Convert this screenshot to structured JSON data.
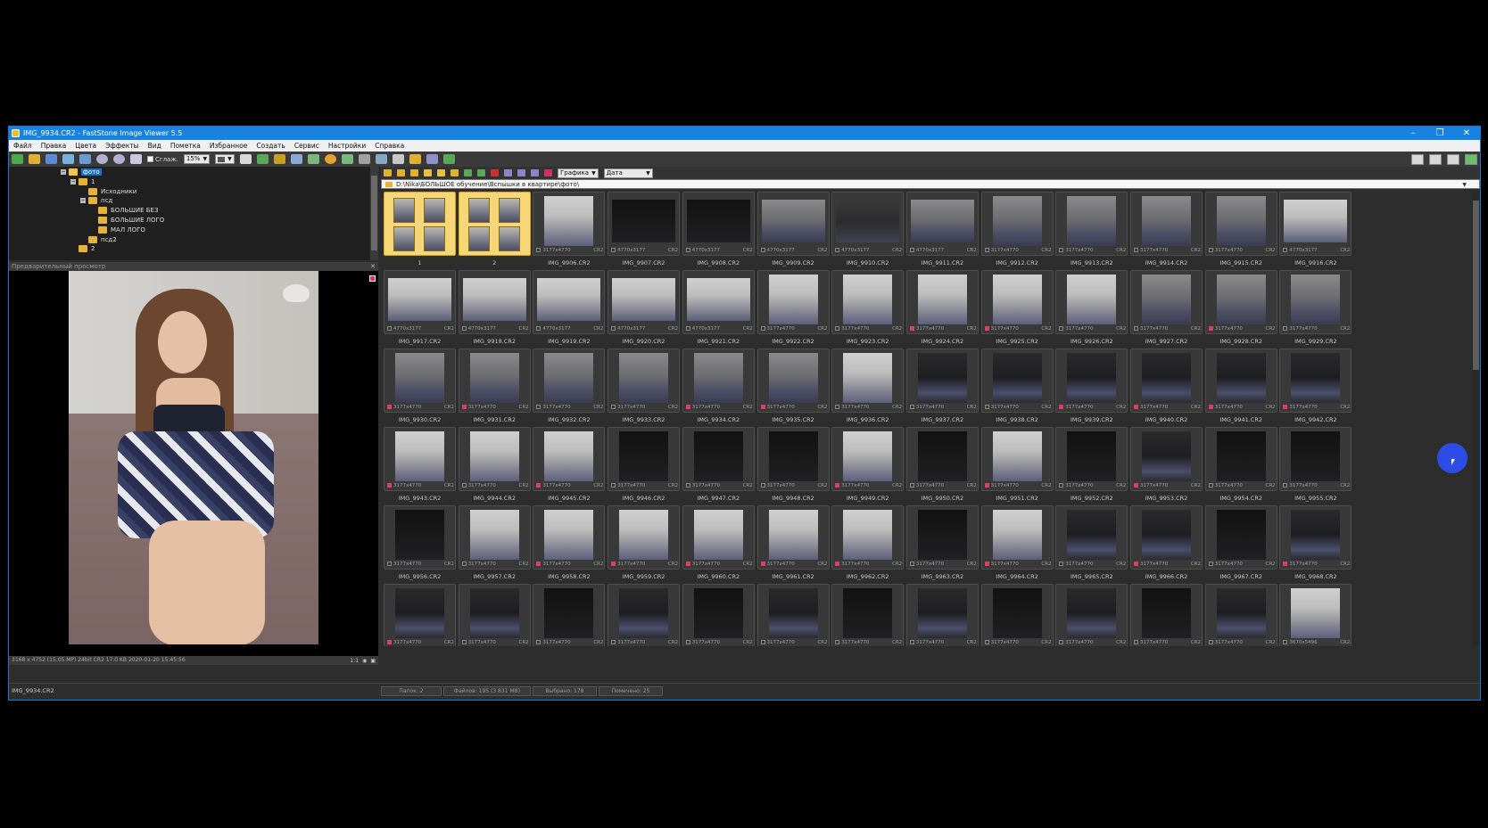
{
  "window": {
    "title": "IMG_9934.CR2 - FastStone Image Viewer 5.5",
    "minimize": "–",
    "maximize": "❐",
    "close": "✕"
  },
  "menu": [
    "Файл",
    "Правка",
    "Цвета",
    "Эффекты",
    "Вид",
    "Пометка",
    "Избранное",
    "Создать",
    "Сервис",
    "Настройки",
    "Справка"
  ],
  "toolbar": {
    "zoom_value": "15%",
    "smooth_label": "Сглаж."
  },
  "browser_toolbar": {
    "view_mode": "Графика",
    "sort_mode": "Дата"
  },
  "address": {
    "path": "D:\\Nika\\БОЛЬШОЕ обучение\\Вспышки в квартире\\фото\\"
  },
  "tree": [
    {
      "label": "фото",
      "level": 0,
      "selected": true,
      "expander": "−"
    },
    {
      "label": "1",
      "level": 1,
      "selected": false,
      "expander": "−"
    },
    {
      "label": "Исходники",
      "level": 2,
      "selected": false,
      "expander": ""
    },
    {
      "label": "псд",
      "level": 2,
      "selected": false,
      "expander": "−"
    },
    {
      "label": "БОЛЬШИЕ БЕЗ",
      "level": 3,
      "selected": false,
      "expander": ""
    },
    {
      "label": "БОЛЬШИЕ ЛОГО",
      "level": 3,
      "selected": false,
      "expander": ""
    },
    {
      "label": "МАЛ ЛОГО",
      "level": 3,
      "selected": false,
      "expander": ""
    },
    {
      "label": "псд2",
      "level": 2,
      "selected": false,
      "expander": ""
    },
    {
      "label": "2",
      "level": 1,
      "selected": false,
      "expander": ""
    }
  ],
  "preview": {
    "header": "Предварительный просмотр",
    "status": "3168 x 4752 (15.05 MP)  24bit  CR2  17.0 KB  2020-01-20 15:45:56",
    "ratio": "1:1"
  },
  "thumbnails": [
    {
      "name": "1",
      "folder": true,
      "selected": true
    },
    {
      "name": "2",
      "folder": true,
      "selected": true
    },
    {
      "name": "IMG_9906.CR2",
      "dims": "3177x4770",
      "ext": "CR2",
      "tagged": false,
      "tone": "light"
    },
    {
      "name": "IMG_9907.CR2",
      "dims": "4770x3177",
      "ext": "CR2",
      "tagged": false,
      "tone": "black"
    },
    {
      "name": "IMG_9908.CR2",
      "dims": "4770x3177",
      "ext": "CR2",
      "tagged": false,
      "tone": "black"
    },
    {
      "name": "IMG_9909.CR2",
      "dims": "4770x3177",
      "ext": "CR2",
      "tagged": false,
      "tone": "mid"
    },
    {
      "name": "IMG_9910.CR2",
      "dims": "4770x3177",
      "ext": "CR2",
      "tagged": false,
      "tone": "darkmid"
    },
    {
      "name": "IMG_9911.CR2",
      "dims": "4770x3177",
      "ext": "CR2",
      "tagged": false,
      "tone": "mid"
    },
    {
      "name": "IMG_9912.CR2",
      "dims": "3177x4770",
      "ext": "CR2",
      "tagged": false,
      "tone": "mid"
    },
    {
      "name": "IMG_9913.CR2",
      "dims": "3177x4770",
      "ext": "CR2",
      "tagged": false,
      "tone": "mid"
    },
    {
      "name": "IMG_9914.CR2",
      "dims": "3177x4770",
      "ext": "CR2",
      "tagged": false,
      "tone": "mid"
    },
    {
      "name": "IMG_9915.CR2",
      "dims": "3177x4770",
      "ext": "CR2",
      "tagged": false,
      "tone": "mid"
    },
    {
      "name": "IMG_9916.CR2",
      "dims": "4770x3177",
      "ext": "CR2",
      "tagged": false,
      "tone": "light"
    },
    {
      "name": "IMG_9917.CR2",
      "dims": "4770x3177",
      "ext": "CR2",
      "tagged": false,
      "tone": "light"
    },
    {
      "name": "IMG_9918.CR2",
      "dims": "4770x3177",
      "ext": "CR2",
      "tagged": false,
      "tone": "light"
    },
    {
      "name": "IMG_9919.CR2",
      "dims": "4770x3177",
      "ext": "CR2",
      "tagged": false,
      "tone": "light"
    },
    {
      "name": "IMG_9920.CR2",
      "dims": "4770x3177",
      "ext": "CR2",
      "tagged": false,
      "tone": "light"
    },
    {
      "name": "IMG_9921.CR2",
      "dims": "4770x3177",
      "ext": "CR2",
      "tagged": false,
      "tone": "light"
    },
    {
      "name": "IMG_9922.CR2",
      "dims": "3177x4770",
      "ext": "CR2",
      "tagged": false,
      "tone": "light"
    },
    {
      "name": "IMG_9923.CR2",
      "dims": "3177x4770",
      "ext": "CR2",
      "tagged": false,
      "tone": "light"
    },
    {
      "name": "IMG_9924.CR2",
      "dims": "3177x4770",
      "ext": "CR2",
      "tagged": true,
      "tone": "light"
    },
    {
      "name": "IMG_9925.CR2",
      "dims": "3177x4770",
      "ext": "CR2",
      "tagged": true,
      "tone": "light"
    },
    {
      "name": "IMG_9926.CR2",
      "dims": "3177x4770",
      "ext": "CR2",
      "tagged": false,
      "tone": "light"
    },
    {
      "name": "IMG_9927.CR2",
      "dims": "3177x4770",
      "ext": "CR2",
      "tagged": false,
      "tone": "mid"
    },
    {
      "name": "IMG_9928.CR2",
      "dims": "3177x4770",
      "ext": "CR2",
      "tagged": true,
      "tone": "mid"
    },
    {
      "name": "IMG_9929.CR2",
      "dims": "3177x4770",
      "ext": "CR2",
      "tagged": false,
      "tone": "mid"
    },
    {
      "name": "IMG_9930.CR2",
      "dims": "3177x4770",
      "ext": "CR2",
      "tagged": true,
      "tone": "mid"
    },
    {
      "name": "IMG_9931.CR2",
      "dims": "3177x4770",
      "ext": "CR2",
      "tagged": true,
      "tone": "mid"
    },
    {
      "name": "IMG_9932.CR2",
      "dims": "3177x4770",
      "ext": "CR2",
      "tagged": false,
      "tone": "mid"
    },
    {
      "name": "IMG_9933.CR2",
      "dims": "3177x4770",
      "ext": "CR2",
      "tagged": false,
      "tone": "mid"
    },
    {
      "name": "IMG_9934.CR2",
      "dims": "3177x4770",
      "ext": "CR2",
      "tagged": true,
      "tone": "mid"
    },
    {
      "name": "IMG_9935.CR2",
      "dims": "3177x4770",
      "ext": "CR2",
      "tagged": true,
      "tone": "mid"
    },
    {
      "name": "IMG_9936.CR2",
      "dims": "3177x4770",
      "ext": "CR2",
      "tagged": false,
      "tone": "light"
    },
    {
      "name": "IMG_9937.CR2",
      "dims": "3177x4770",
      "ext": "CR2",
      "tagged": false,
      "tone": "dark"
    },
    {
      "name": "IMG_9938.CR2",
      "dims": "3177x4770",
      "ext": "CR2",
      "tagged": false,
      "tone": "dark"
    },
    {
      "name": "IMG_9939.CR2",
      "dims": "3177x4770",
      "ext": "CR2",
      "tagged": true,
      "tone": "dark"
    },
    {
      "name": "IMG_9940.CR2",
      "dims": "3177x4770",
      "ext": "CR2",
      "tagged": true,
      "tone": "dark"
    },
    {
      "name": "IMG_9941.CR2",
      "dims": "3177x4770",
      "ext": "CR2",
      "tagged": true,
      "tone": "dark"
    },
    {
      "name": "IMG_9942.CR2",
      "dims": "3177x4770",
      "ext": "CR2",
      "tagged": true,
      "tone": "dark"
    },
    {
      "name": "IMG_9943.CR2",
      "dims": "3177x4770",
      "ext": "CR2",
      "tagged": true,
      "tone": "light"
    },
    {
      "name": "IMG_9944.CR2",
      "dims": "3177x4770",
      "ext": "CR2",
      "tagged": false,
      "tone": "light"
    },
    {
      "name": "IMG_9945.CR2",
      "dims": "3177x4770",
      "ext": "CR2",
      "tagged": true,
      "tone": "light"
    },
    {
      "name": "IMG_9946.CR2",
      "dims": "3177x4770",
      "ext": "CR2",
      "tagged": false,
      "tone": "black"
    },
    {
      "name": "IMG_9947.CR2",
      "dims": "3177x4770",
      "ext": "CR2",
      "tagged": false,
      "tone": "black"
    },
    {
      "name": "IMG_9948.CR2",
      "dims": "3177x4770",
      "ext": "CR2",
      "tagged": false,
      "tone": "black"
    },
    {
      "name": "IMG_9949.CR2",
      "dims": "3177x4770",
      "ext": "CR2",
      "tagged": true,
      "tone": "light"
    },
    {
      "name": "IMG_9950.CR2",
      "dims": "3177x4770",
      "ext": "CR2",
      "tagged": false,
      "tone": "black"
    },
    {
      "name": "IMG_9951.CR2",
      "dims": "3177x4770",
      "ext": "CR2",
      "tagged": true,
      "tone": "light"
    },
    {
      "name": "IMG_9952.CR2",
      "dims": "3177x4770",
      "ext": "CR2",
      "tagged": false,
      "tone": "black"
    },
    {
      "name": "IMG_9953.CR2",
      "dims": "3177x4770",
      "ext": "CR2",
      "tagged": true,
      "tone": "dark"
    },
    {
      "name": "IMG_9954.CR2",
      "dims": "3177x4770",
      "ext": "CR2",
      "tagged": false,
      "tone": "black"
    },
    {
      "name": "IMG_9955.CR2",
      "dims": "3177x4770",
      "ext": "CR2",
      "tagged": false,
      "tone": "black"
    },
    {
      "name": "IMG_9956.CR2",
      "dims": "3177x4770",
      "ext": "CR2",
      "tagged": false,
      "tone": "black"
    },
    {
      "name": "IMG_9957.CR2",
      "dims": "3177x4770",
      "ext": "CR2",
      "tagged": false,
      "tone": "light"
    },
    {
      "name": "IMG_9958.CR2",
      "dims": "3177x4770",
      "ext": "CR2",
      "tagged": true,
      "tone": "light"
    },
    {
      "name": "IMG_9959.CR2",
      "dims": "3177x4770",
      "ext": "CR2",
      "tagged": true,
      "tone": "light"
    },
    {
      "name": "IMG_9960.CR2",
      "dims": "3177x4770",
      "ext": "CR2",
      "tagged": true,
      "tone": "light"
    },
    {
      "name": "IMG_9961.CR2",
      "dims": "3177x4770",
      "ext": "CR2",
      "tagged": true,
      "tone": "light"
    },
    {
      "name": "IMG_9962.CR2",
      "dims": "3177x4770",
      "ext": "CR2",
      "tagged": true,
      "tone": "light"
    },
    {
      "name": "IMG_9963.CR2",
      "dims": "3177x4770",
      "ext": "CR2",
      "tagged": false,
      "tone": "black"
    },
    {
      "name": "IMG_9964.CR2",
      "dims": "3177x4770",
      "ext": "CR2",
      "tagged": true,
      "tone": "light"
    },
    {
      "name": "IMG_9965.CR2",
      "dims": "3177x4770",
      "ext": "CR2",
      "tagged": false,
      "tone": "dark"
    },
    {
      "name": "IMG_9966.CR2",
      "dims": "3177x4770",
      "ext": "CR2",
      "tagged": true,
      "tone": "dark"
    },
    {
      "name": "IMG_9967.CR2",
      "dims": "3177x4770",
      "ext": "CR2",
      "tagged": false,
      "tone": "black"
    },
    {
      "name": "IMG_9968.CR2",
      "dims": "3177x4770",
      "ext": "CR2",
      "tagged": true,
      "tone": "dark"
    },
    {
      "name": "",
      "dims": "3177x4770",
      "ext": "CR2",
      "tagged": true,
      "tone": "dark"
    },
    {
      "name": "",
      "dims": "3177x4770",
      "ext": "CR2",
      "tagged": false,
      "tone": "dark"
    },
    {
      "name": "",
      "dims": "3177x4770",
      "ext": "CR2",
      "tagged": false,
      "tone": "black"
    },
    {
      "name": "",
      "dims": "3177x4770",
      "ext": "CR2",
      "tagged": false,
      "tone": "dark"
    },
    {
      "name": "",
      "dims": "3177x4770",
      "ext": "CR2",
      "tagged": false,
      "tone": "black"
    },
    {
      "name": "",
      "dims": "3177x4770",
      "ext": "CR2",
      "tagged": false,
      "tone": "dark"
    },
    {
      "name": "",
      "dims": "3177x4770",
      "ext": "CR2",
      "tagged": false,
      "tone": "black"
    },
    {
      "name": "",
      "dims": "3177x4770",
      "ext": "CR2",
      "tagged": false,
      "tone": "dark"
    },
    {
      "name": "",
      "dims": "3177x4770",
      "ext": "CR2",
      "tagged": false,
      "tone": "black"
    },
    {
      "name": "",
      "dims": "3177x4770",
      "ext": "CR2",
      "tagged": false,
      "tone": "dark"
    },
    {
      "name": "",
      "dims": "3177x4770",
      "ext": "CR2",
      "tagged": false,
      "tone": "black"
    },
    {
      "name": "",
      "dims": "3177x4770",
      "ext": "CR2",
      "tagged": false,
      "tone": "dark"
    },
    {
      "name": "",
      "dims": "3670x5496",
      "ext": "CR2",
      "tagged": false,
      "tone": "light"
    }
  ],
  "statusbar": {
    "current_file": "IMG_9934.CR2",
    "folders": "Папок: 2",
    "files": "Файлов: 195 (3 831 MB)",
    "selected": "Выбрано: 178",
    "tagged": "Помечено: 25"
  },
  "colors": {
    "titlebar": "#1782e0",
    "tag": "#d8406a",
    "folder_selected": "#f5d77a",
    "accent_dot": "#2d4ee6"
  }
}
